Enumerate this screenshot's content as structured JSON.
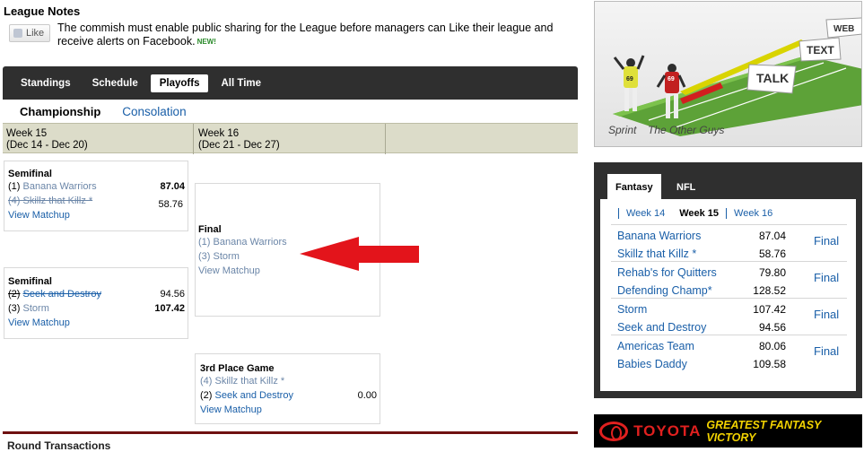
{
  "notes": {
    "title": "League Notes",
    "like_label": "Like",
    "text": "The commish must enable public sharing for the League before managers can Like their league and receive alerts on Facebook.",
    "new_badge": "NEW!"
  },
  "nav": {
    "tabs": [
      "Standings",
      "Schedule",
      "Playoffs",
      "All Time"
    ],
    "active": "Playoffs"
  },
  "subtabs": {
    "championship": "Championship",
    "consolation": "Consolation"
  },
  "weeks": [
    {
      "label": "Week 15",
      "range": "(Dec 14 - Dec 20)"
    },
    {
      "label": "Week 16",
      "range": "(Dec 21 - Dec 27)"
    }
  ],
  "bracket": {
    "semi1": {
      "title": "Semifinal",
      "teams": [
        {
          "seed": "(1)",
          "name": "Banana Warriors",
          "score": "87.04"
        },
        {
          "seed": "(4)",
          "name": "Skillz that Killz *",
          "score": "58.76"
        }
      ],
      "link": "View Matchup"
    },
    "semi2": {
      "title": "Semifinal",
      "teams": [
        {
          "seed": "(2)",
          "name": "Seek and Destroy",
          "score": "94.56"
        },
        {
          "seed": "(3)",
          "name": "Storm",
          "score": "107.42"
        }
      ],
      "link": "View Matchup"
    },
    "final": {
      "title": "Final",
      "teams": [
        {
          "seed": "(1)",
          "name": "Banana Warriors"
        },
        {
          "seed": "(3)",
          "name": "Storm"
        }
      ],
      "link": "View Matchup"
    },
    "third": {
      "title": "3rd Place Game",
      "teams": [
        {
          "seed": "(4)",
          "name": "Skillz that Killz *",
          "score": ""
        },
        {
          "seed": "(2)",
          "name": "Seek and Destroy",
          "score": "0.00"
        }
      ],
      "link": "View Matchup"
    }
  },
  "bottom_heading": "Round Transactions",
  "ad": {
    "captions": [
      "Sprint",
      "The Other Guys"
    ],
    "signs": [
      "WEB",
      "TEXT",
      "TALK"
    ],
    "jerseys": [
      "69",
      "69"
    ]
  },
  "scores_panel": {
    "tabs": [
      "Fantasy",
      "NFL"
    ],
    "weeks": [
      "Week 14",
      "Week 15",
      "Week 16"
    ],
    "active_week": "Week 15",
    "matchups": [
      {
        "team1": "Banana Warriors",
        "score1": "87.04",
        "team2": "Skillz that Killz *",
        "score2": "58.76",
        "status": "Final"
      },
      {
        "team1": "Rehab's for Quitters",
        "score1": "79.80",
        "team2": "Defending Champ*",
        "score2": "128.52",
        "status": "Final"
      },
      {
        "team1": "Storm",
        "score1": "107.42",
        "team2": "Seek and Destroy",
        "score2": "94.56",
        "status": "Final"
      },
      {
        "team1": "Americas Team",
        "score1": "80.06",
        "team2": "Babies Daddy",
        "score2": "109.58",
        "status": "Final"
      }
    ]
  },
  "toyota": {
    "brand": "TOYOTA",
    "tagline": "GREATEST FANTASY VICTORY"
  },
  "colors": {
    "link": "#1a5fa8",
    "nav_bg": "#2f2f2f",
    "week_header_bg": "#dcdcc9",
    "arrow": "#e3141b"
  }
}
